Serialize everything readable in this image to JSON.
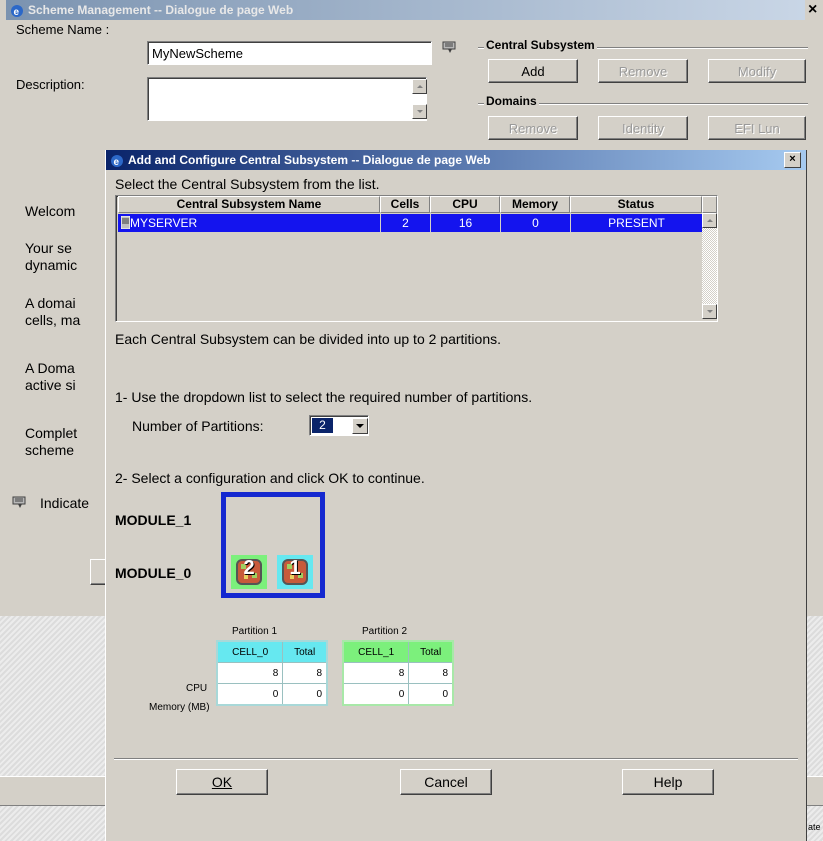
{
  "outer": {
    "title": "Scheme Management -- Dialogue de page Web",
    "close": "×",
    "scheme_name_label": "Scheme Name :",
    "scheme_name_value": "MyNewScheme",
    "description_label": "Description:",
    "central_subsystem_group": "Central Subsystem",
    "cs_add": "Add",
    "cs_remove": "Remove",
    "cs_modify": "Modify",
    "domains_group": "Domains",
    "dom_remove": "Remove",
    "dom_identity": "Identity",
    "dom_efi_lun": "EFI Lun",
    "left_fragments": [
      "Welcom",
      "Your se",
      "dynamic",
      "A domai",
      "cells, ma",
      "A Doma",
      "active si",
      "Complet",
      "scheme"
    ],
    "indicate_fragment": "Indicate",
    "bottom_fragment": "ate"
  },
  "dialog": {
    "title": "Add and Configure Central Subsystem -- Dialogue de page Web",
    "close": "×",
    "select_prompt": "Select the Central Subsystem from the list.",
    "columns": [
      "Central Subsystem Name",
      "Cells",
      "CPU",
      "Memory",
      "Status"
    ],
    "rows": [
      {
        "name": "MYSERVER",
        "cells": "2",
        "cpu": "16",
        "memory": "0",
        "status": "PRESENT"
      }
    ],
    "partition_note": "Each Central Subsystem can be divided into up to 2 partitions.",
    "step1": "1- Use the dropdown list to select the required number of partitions.",
    "num_partitions_label": "Number of Partitions:",
    "num_partitions_value": "2",
    "step2": "2- Select a configuration and click OK to continue.",
    "module_1": "MODULE_1",
    "module_0": "MODULE_0",
    "cell_2_label": "2",
    "cell_1_label": "1",
    "partitions": [
      {
        "title": "Partition 1",
        "cell": "CELL_0",
        "total": "Total",
        "cpu_cell": "8",
        "cpu_total": "8",
        "mem_cell": "0",
        "mem_total": "0",
        "color": "#66e8f0"
      },
      {
        "title": "Partition 2",
        "cell": "CELL_1",
        "total": "Total",
        "cpu_cell": "8",
        "cpu_total": "8",
        "mem_cell": "0",
        "mem_total": "0",
        "color": "#7cf07c"
      }
    ],
    "row_cpu": "CPU",
    "row_memory": "Memory (MB)",
    "ok": "OK",
    "cancel": "Cancel",
    "help": "Help"
  },
  "colors": {
    "title_gradient_start": "#0a246a",
    "title_gradient_end": "#a6caf0",
    "selection": "#1414ee",
    "module_border": "#1428d0"
  }
}
